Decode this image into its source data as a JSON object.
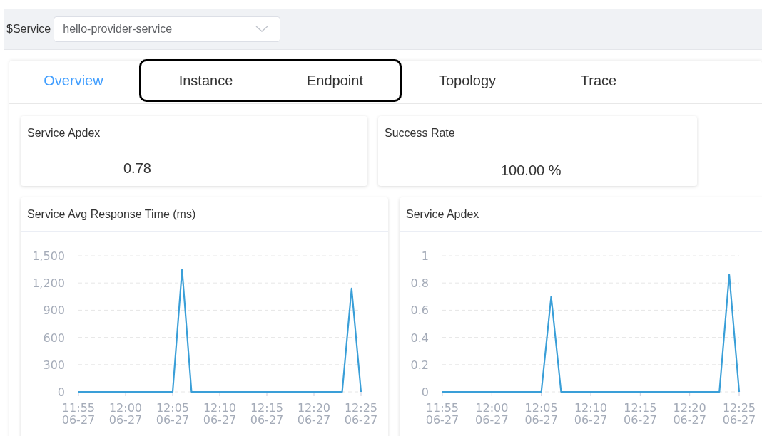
{
  "filter_bar": {
    "label": "$Service",
    "select": {
      "value": "hello-provider-service"
    }
  },
  "tabs": [
    {
      "label": "Overview",
      "selected": true,
      "highlighted": false
    },
    {
      "label": "Instance",
      "selected": false,
      "highlighted": true
    },
    {
      "label": "Endpoint",
      "selected": false,
      "highlighted": true
    },
    {
      "label": "Topology",
      "selected": false,
      "highlighted": false
    },
    {
      "label": "Trace",
      "selected": false,
      "highlighted": false
    }
  ],
  "stat_cards": [
    {
      "title": "Service Apdex",
      "value": "0.78"
    },
    {
      "title": "Success Rate",
      "value": "100.00 %"
    }
  ],
  "chart_cards": [
    {
      "title": "Service Avg Response Time (ms)",
      "chart_data": {
        "type": "line",
        "grid": true,
        "categories": [
          "11:55 06-27",
          null,
          null,
          null,
          null,
          "12:00 06-27",
          null,
          null,
          null,
          null,
          "12:05 06-27",
          null,
          null,
          null,
          null,
          "12:10 06-27",
          null,
          null,
          null,
          null,
          "12:15 06-27",
          null,
          null,
          null,
          null,
          "12:20 06-27",
          null,
          null,
          null,
          null,
          "12:25 06-27"
        ],
        "series": [
          {
            "color": "#3a9fd8",
            "values": [
              0,
              0,
              0,
              0,
              0,
              0,
              0,
              0,
              0,
              0,
              0,
              1350,
              0,
              0,
              0,
              0,
              0,
              0,
              0,
              0,
              0,
              0,
              0,
              0,
              0,
              0,
              0,
              0,
              0,
              1140,
              0
            ]
          }
        ],
        "ylim": [
          0,
          1500
        ],
        "yticks": [
          {
            "value": 0,
            "label": "0"
          },
          {
            "value": 300,
            "label": "300"
          },
          {
            "value": 600,
            "label": "600"
          },
          {
            "value": 900,
            "label": "900"
          },
          {
            "value": 1200,
            "label": "1,200"
          },
          {
            "value": 1500,
            "label": "1,500"
          }
        ]
      }
    },
    {
      "title": "Service Apdex",
      "chart_data": {
        "type": "line",
        "grid": true,
        "categories": [
          "11:55 06-27",
          null,
          null,
          null,
          null,
          "12:00 06-27",
          null,
          null,
          null,
          null,
          "12:05 06-27",
          null,
          null,
          null,
          null,
          "12:10 06-27",
          null,
          null,
          null,
          null,
          "12:15 06-27",
          null,
          null,
          null,
          null,
          "12:20 06-27",
          null,
          null,
          null,
          null,
          "12:25 06-27"
        ],
        "series": [
          {
            "color": "#3a9fd8",
            "values": [
              0,
              0,
              0,
              0,
              0,
              0,
              0,
              0,
              0,
              0,
              0,
              0.7,
              0,
              0,
              0,
              0,
              0,
              0,
              0,
              0,
              0,
              0,
              0,
              0,
              0,
              0,
              0,
              0,
              0,
              0.86,
              0
            ]
          }
        ],
        "ylim": [
          0,
          1
        ],
        "yticks": [
          {
            "value": 0,
            "label": "0"
          },
          {
            "value": 0.2,
            "label": "0.2"
          },
          {
            "value": 0.4,
            "label": "0.4"
          },
          {
            "value": 0.6,
            "label": "0.6"
          },
          {
            "value": 0.8,
            "label": "0.8"
          },
          {
            "value": 1,
            "label": "1"
          }
        ]
      }
    }
  ]
}
